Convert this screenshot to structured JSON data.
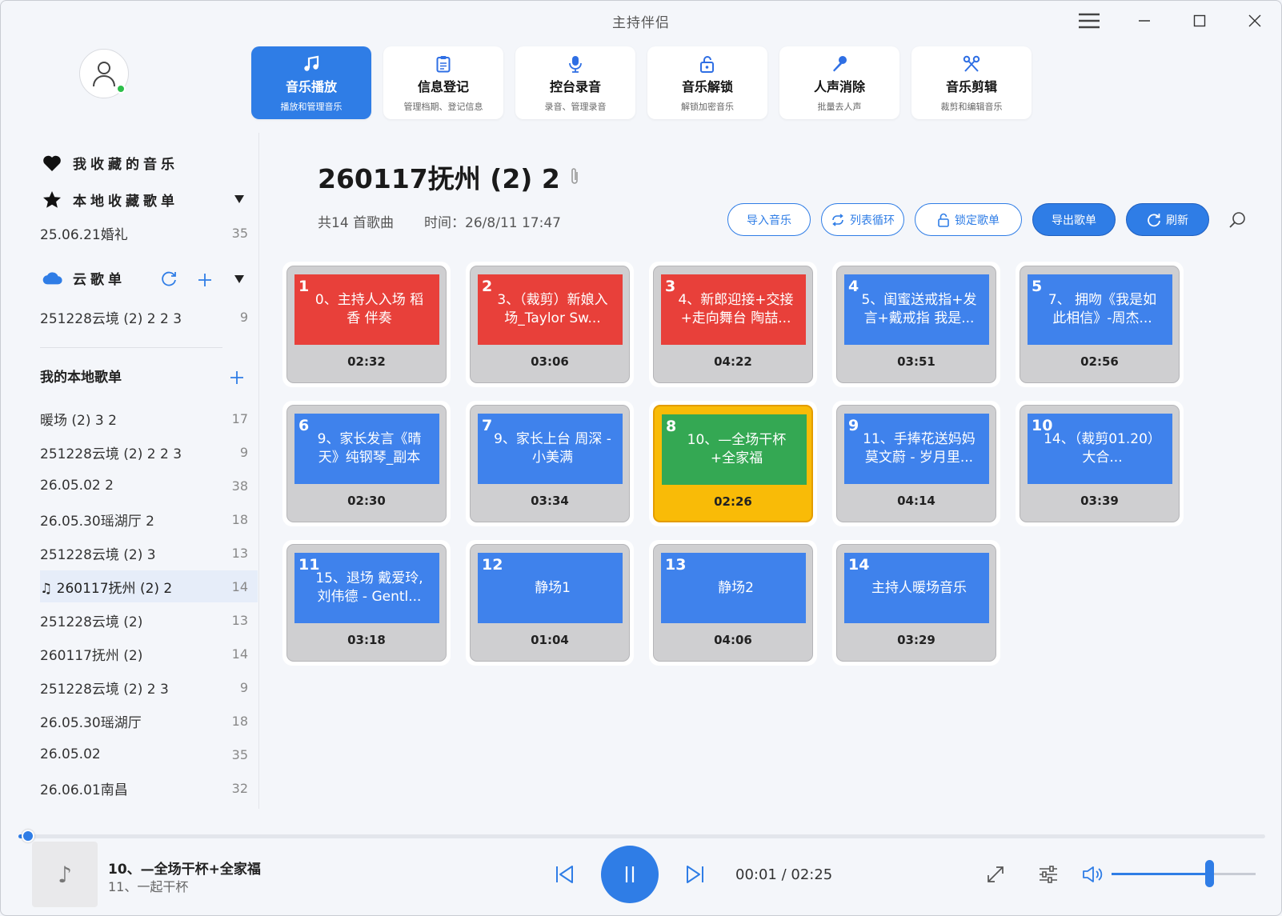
{
  "app": {
    "title": "主持伴侣"
  },
  "colors": {
    "accent": "#2f7de6",
    "red": "#e8403a",
    "blue": "#3f82ec",
    "green": "#34a853",
    "playing": "#f9bb07"
  },
  "nav": [
    {
      "icon": "music-note-icon",
      "label": "音乐播放",
      "sub": "播放和管理音乐",
      "active": true
    },
    {
      "icon": "clipboard-icon",
      "label": "信息登记",
      "sub": "管理档期、登记信息",
      "active": false
    },
    {
      "icon": "microphone-icon",
      "label": "控台录音",
      "sub": "录音、管理录音",
      "active": false
    },
    {
      "icon": "unlock-icon",
      "label": "音乐解锁",
      "sub": "解锁加密音乐",
      "active": false
    },
    {
      "icon": "mic-remove-icon",
      "label": "人声消除",
      "sub": "批量去人声",
      "active": false
    },
    {
      "icon": "scissors-icon",
      "label": "音乐剪辑",
      "sub": "裁剪和编辑音乐",
      "active": false
    }
  ],
  "sidebar": {
    "favorites": "我收藏的音乐",
    "local_fav": "本地收藏歌单",
    "local_fav_items": [
      {
        "name": "25.06.21婚礼",
        "count": "35"
      }
    ],
    "cloud": "云歌单",
    "cloud_items": [
      {
        "name": "251228云境 (2) 2 2 3",
        "count": "9"
      }
    ],
    "my_local": "我的本地歌单",
    "playlists": [
      {
        "name": "暖场 (2) 3 2",
        "count": "17"
      },
      {
        "name": "251228云境 (2) 2 2 3",
        "count": "9"
      },
      {
        "name": "26.05.02 2",
        "count": "38"
      },
      {
        "name": "26.05.30瑶湖厅 2",
        "count": "18"
      },
      {
        "name": "251228云境 (2) 3",
        "count": "13"
      },
      {
        "name": "♫ 260117抚州 (2) 2",
        "count": "14",
        "active": true
      },
      {
        "name": "251228云境 (2)",
        "count": "13"
      },
      {
        "name": "260117抚州 (2)",
        "count": "14"
      },
      {
        "name": "251228云境 (2) 2 3",
        "count": "9"
      },
      {
        "name": "26.05.30瑶湖厅",
        "count": "18"
      },
      {
        "name": "26.05.02",
        "count": "35"
      },
      {
        "name": "26.06.01南昌",
        "count": "32"
      }
    ]
  },
  "playlist": {
    "title": "260117抚州 (2) 2",
    "count_text": "共14 首歌曲",
    "time_text": "时间：26/8/11 17:47"
  },
  "actions": {
    "import": "导入音乐",
    "loop": "列表循环",
    "lock": "锁定歌单",
    "export": "导出歌单",
    "refresh": "刷新"
  },
  "songs": [
    {
      "num": "1",
      "title": "0、主持人入场 稻香 伴奏",
      "duration": "02:32",
      "color": "red"
    },
    {
      "num": "2",
      "title": "3、（裁剪）新娘入场_Taylor Sw...",
      "duration": "03:06",
      "color": "red"
    },
    {
      "num": "3",
      "title": "4、新郎迎接+交接+走向舞台 陶喆...",
      "duration": "04:22",
      "color": "red"
    },
    {
      "num": "4",
      "title": "5、闺蜜送戒指+发言+戴戒指 我是...",
      "duration": "03:51",
      "color": "blue"
    },
    {
      "num": "5",
      "title": "7、 拥吻《我是如此相信》-周杰...",
      "duration": "02:56",
      "color": "blue"
    },
    {
      "num": "6",
      "title": "9、家长发言《晴天》纯钢琴_副本",
      "duration": "02:30",
      "color": "blue"
    },
    {
      "num": "7",
      "title": "9、家长上台 周深 - 小美满",
      "duration": "03:34",
      "color": "blue"
    },
    {
      "num": "8",
      "title": "10、—全场干杯+全家福",
      "duration": "02:26",
      "color": "green",
      "playing": true
    },
    {
      "num": "9",
      "title": "11、手捧花送妈妈 莫文蔚 - 岁月里...",
      "duration": "04:14",
      "color": "blue"
    },
    {
      "num": "10",
      "title": "14、（裁剪01.20） 大合...",
      "duration": "03:39",
      "color": "blue"
    },
    {
      "num": "11",
      "title": "15、退场 戴爱玲,刘伟德 - Gentl...",
      "duration": "03:18",
      "color": "blue"
    },
    {
      "num": "12",
      "title": "静场1",
      "duration": "01:04",
      "color": "blue"
    },
    {
      "num": "13",
      "title": "静场2",
      "duration": "04:06",
      "color": "blue"
    },
    {
      "num": "14",
      "title": "主持人暖场音乐",
      "duration": "03:29",
      "color": "blue"
    }
  ],
  "player": {
    "now_title": "10、—全场干杯+全家福",
    "next_title": "11、一起干杯",
    "elapsed": "00:01",
    "total": "02:25",
    "time_text": "00:01 / 02:25",
    "progress": 0.007,
    "volume": 0.68
  }
}
